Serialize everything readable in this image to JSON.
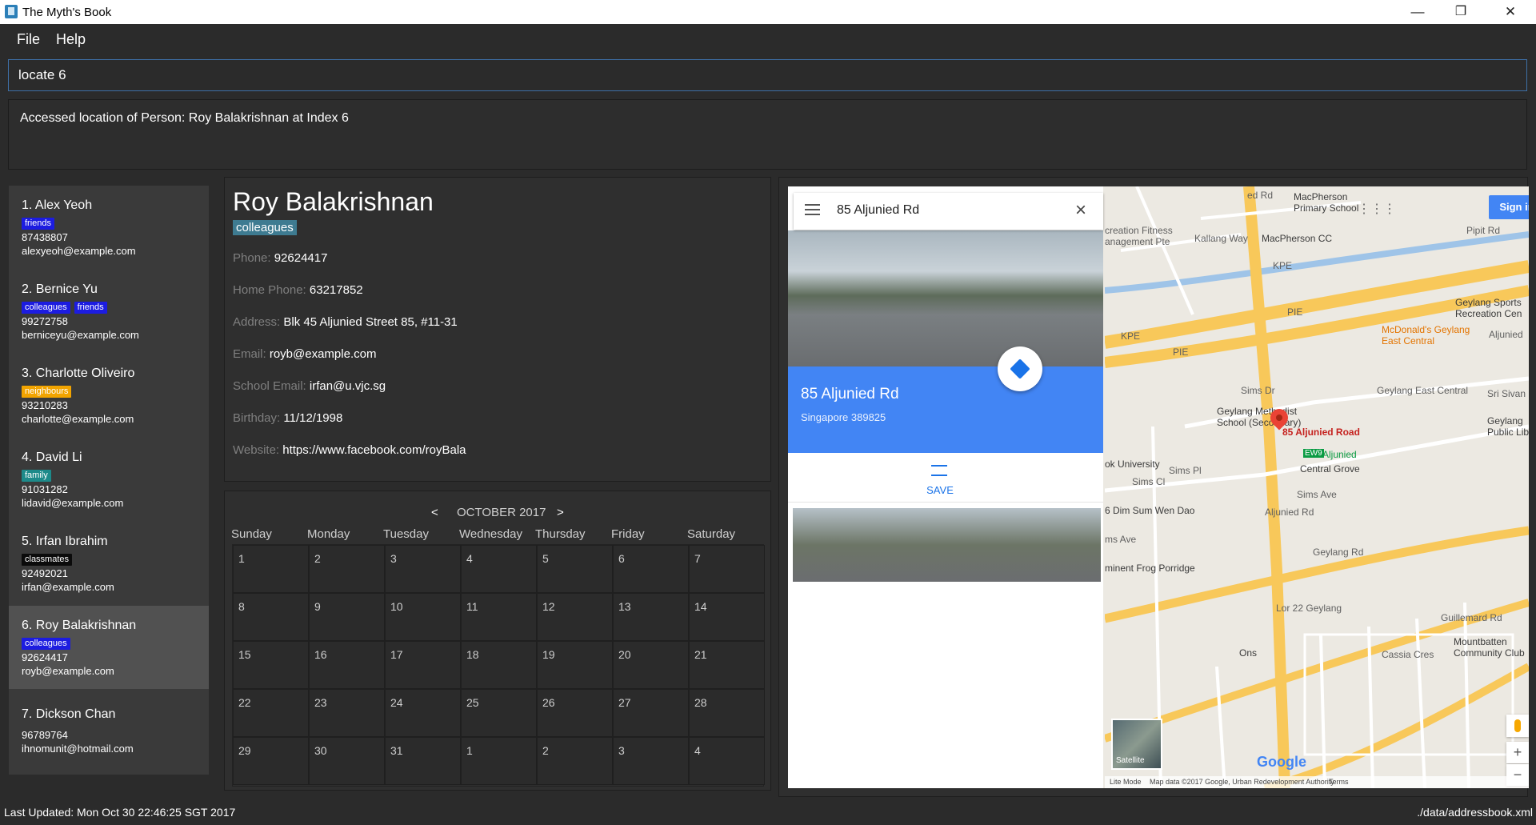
{
  "window": {
    "title": "The Myth's Book",
    "controls": {
      "minimize": "—",
      "maximize": "❐",
      "close": "✕"
    }
  },
  "menu": {
    "file": "File",
    "help": "Help"
  },
  "command": {
    "value": "locate 6"
  },
  "result": {
    "text": "Accessed location of Person: Roy Balakrishnan at Index 6"
  },
  "persons": [
    {
      "name": "1.  Alex Yeoh",
      "tags": [
        {
          "label": "friends",
          "color": "#1c1ce0"
        }
      ],
      "phone": "87438807",
      "email": "alexyeoh@example.com"
    },
    {
      "name": "2.  Bernice Yu",
      "tags": [
        {
          "label": "colleagues",
          "color": "#1c1ce0"
        },
        {
          "label": "friends",
          "color": "#1c1ce0"
        }
      ],
      "phone": "99272758",
      "email": "berniceyu@example.com"
    },
    {
      "name": "3.  Charlotte Oliveiro",
      "tags": [
        {
          "label": "neighbours",
          "color": "#f2a400"
        }
      ],
      "phone": "93210283",
      "email": "charlotte@example.com"
    },
    {
      "name": "4.  David Li",
      "tags": [
        {
          "label": "family",
          "color": "#1d8a8a"
        }
      ],
      "phone": "91031282",
      "email": "lidavid@example.com"
    },
    {
      "name": "5.  Irfan Ibrahim",
      "tags": [
        {
          "label": "classmates",
          "color": "#0b0b0b"
        }
      ],
      "phone": "92492021",
      "email": "irfan@example.com"
    },
    {
      "name": "6.  Roy Balakrishnan",
      "tags": [
        {
          "label": "colleagues",
          "color": "#1c1ce0"
        }
      ],
      "phone": "92624417",
      "email": "royb@example.com"
    },
    {
      "name": "7.  Dickson Chan",
      "tags": [],
      "phone": "96789764",
      "email": "ihnomunit@hotmail.com"
    }
  ],
  "details": {
    "name": "Roy Balakrishnan",
    "tag": "colleagues",
    "fields": [
      {
        "label": "Phone: ",
        "value": "92624417"
      },
      {
        "label": "Home Phone: ",
        "value": "63217852"
      },
      {
        "label": "Address: ",
        "value": "Blk 45 Aljunied Street 85, #11-31"
      },
      {
        "label": "Email: ",
        "value": "royb@example.com"
      },
      {
        "label": "School Email: ",
        "value": "irfan@u.vjc.sg"
      },
      {
        "label": "Birthday: ",
        "value": "11/12/1998"
      },
      {
        "label": "Website: ",
        "value": "https://www.facebook.com/royBala"
      }
    ]
  },
  "calendar": {
    "prev": "<",
    "next": ">",
    "month": "OCTOBER 2017",
    "days_of_week": [
      "Sunday",
      "Monday",
      "Tuesday",
      "Wednesday",
      "Thursday",
      "Friday",
      "Saturday"
    ],
    "weeks": [
      [
        "1",
        "2",
        "3",
        "4",
        "5",
        "6",
        "7"
      ],
      [
        "8",
        "9",
        "10",
        "11",
        "12",
        "13",
        "14"
      ],
      [
        "15",
        "16",
        "17",
        "18",
        "19",
        "20",
        "21"
      ],
      [
        "22",
        "23",
        "24",
        "25",
        "26",
        "27",
        "28"
      ],
      [
        "29",
        "30",
        "31",
        "1",
        "2",
        "3",
        "4"
      ]
    ]
  },
  "map": {
    "search_query": "85 Aljunied Rd",
    "place_title": "85 Aljunied Rd",
    "place_subtitle": "Singapore 389825",
    "save_label": "SAVE",
    "sign_in": "Sign in",
    "satellite": "Satellite",
    "google": "Google",
    "attribution": {
      "lite": "Lite Mode",
      "data": "Map data ©2017 Google, Urban Redevelopment Authority",
      "terms": "Terms"
    },
    "zoom_in": "+",
    "zoom_out": "−",
    "pin_label": "85 Aljunied Road",
    "labels": {
      "macpherson_school": "MacPherson\nPrimary School",
      "macpherson_cc": "MacPherson CC",
      "pipit": "Pipit Rd",
      "kallang_way": "Kallang Way",
      "kpe1": "KPE",
      "kpe2": "KPE",
      "pie1": "PIE",
      "pie2": "PIE",
      "creation": "creation Fitness\nanagement Pte",
      "geylang_sports": "Geylang Sports\nRecreation Cen",
      "mcdonalds": "McDonald's Geylang\nEast Central",
      "aljunied": "Aljunied",
      "sims_dr": "Sims Dr",
      "geylang_east": "Geylang East Central",
      "sri_sivan": "Sri Sivan",
      "geylang_methodist": "Geylang Methodist\nSchool (Secondary)",
      "geylang_public": "Geylang\nPublic Lib",
      "ew9": "EW9",
      "aljunied_stn": "Aljunied",
      "ok_university": "ok University",
      "sims_pl": "Sims Pl",
      "sims_cl": "Sims Cl",
      "central_grove": "Central Grove",
      "dim_sum": "6 Dim Sum Wen Dao",
      "sims_ave": "Sims Ave",
      "sims_ave2": "ms Ave",
      "eminent": "minent Frog Porridge",
      "geylang_rd": "Geylang Rd",
      "aljunied_rd": "Aljunied Rd",
      "lor22": "Lor 22 Geylang",
      "guillemard": "Guillemard Rd",
      "mountbatten": "Mountbatten\nCommunity Club",
      "cassia": "Cassia Cres",
      "ons": "Ons",
      "red_rd": "ed Rd"
    }
  },
  "status": {
    "left": "Last Updated: Mon Oct 30 22:46:25 SGT 2017",
    "right": "./data/addressbook.xml"
  }
}
